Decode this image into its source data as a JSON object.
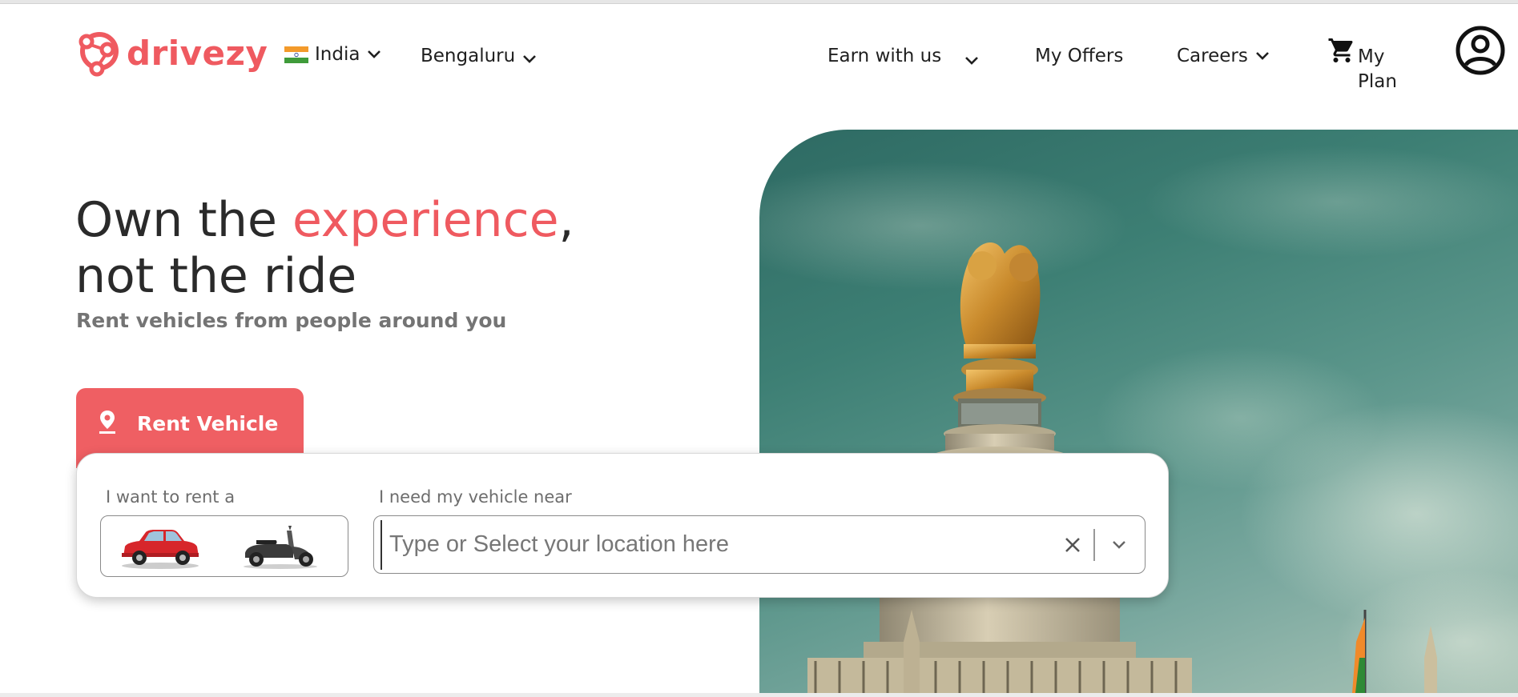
{
  "brand": {
    "name": "drivezy",
    "accent_color": "#ef5a60"
  },
  "header": {
    "country": "India",
    "city": "Bengaluru",
    "nav": {
      "earn": "Earn with us",
      "offers": "My Offers",
      "careers": "Careers",
      "plan_line1": "My",
      "plan_line2": "Plan"
    },
    "icons": {
      "cart": "shopping-cart-icon",
      "account": "account-circle-icon",
      "chevron": "chevron-down-icon"
    }
  },
  "hero": {
    "title_prefix": "Own the ",
    "title_accent": "experience",
    "title_comma": ",",
    "title_line2": "not the ride",
    "subtitle": "Rent vehicles from people around you"
  },
  "tab": {
    "label": "Rent Vehicle",
    "icon": "location-pin-icon"
  },
  "search": {
    "vehicle_label": "I want to rent a",
    "vehicle_options": [
      "car",
      "scooter"
    ],
    "location_label": "I need my vehicle near",
    "location_placeholder": "Type or Select your location here",
    "location_value": ""
  }
}
